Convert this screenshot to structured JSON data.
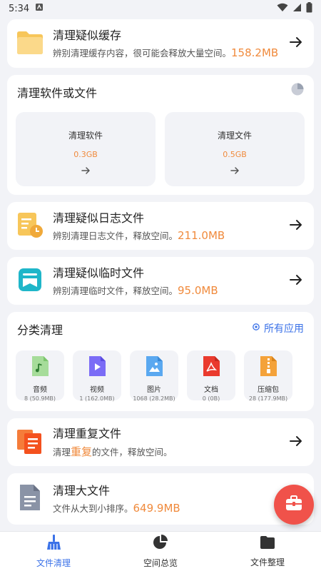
{
  "status_bar": {
    "time": "5:34"
  },
  "cache_card": {
    "title": "清理疑似缓存",
    "subtitle": "辨别清理缓存内容，很可能会释放大量空间。",
    "value": "158.2MB"
  },
  "software_section": {
    "title": "清理软件或文件",
    "items": [
      {
        "label": "清理软件",
        "value": "0.3GB"
      },
      {
        "label": "清理文件",
        "value": "0.5GB"
      }
    ]
  },
  "log_card": {
    "title": "清理疑似日志文件",
    "subtitle": "辨别清理日志文件，释放空间。",
    "value": "211.0MB"
  },
  "temp_card": {
    "title": "清理疑似临时文件",
    "subtitle": "辨别清理临时文件，释放空间。",
    "value": "95.0MB"
  },
  "category_section": {
    "title": "分类清理",
    "all_apps_label": "所有应用",
    "items": [
      {
        "name": "音频",
        "count": "8 (50.9MB)"
      },
      {
        "name": "视频",
        "count": "1 (162.0MB)"
      },
      {
        "name": "图片",
        "count": "1068 (28.2MB)"
      },
      {
        "name": "文档",
        "count": "0 (0B)"
      },
      {
        "name": "压缩包",
        "count": "28 (177.9MB)"
      }
    ]
  },
  "duplicate_card": {
    "title": "清理重复文件",
    "subtitle_prefix": "清理",
    "subtitle_highlight": "重复",
    "subtitle_suffix": "的文件，释放空间。"
  },
  "large_card": {
    "title": "清理大文件",
    "subtitle": "文件从大到小排序。",
    "value": "649.9MB"
  },
  "nav": [
    {
      "label": "文件清理",
      "active": true
    },
    {
      "label": "空间总览",
      "active": false
    },
    {
      "label": "文件整理",
      "active": false
    }
  ],
  "colors": {
    "accent_orange": "#f08a3c",
    "accent_blue": "#3b72e8",
    "fab_red": "#f0524a",
    "background": "#f2f3f7"
  }
}
